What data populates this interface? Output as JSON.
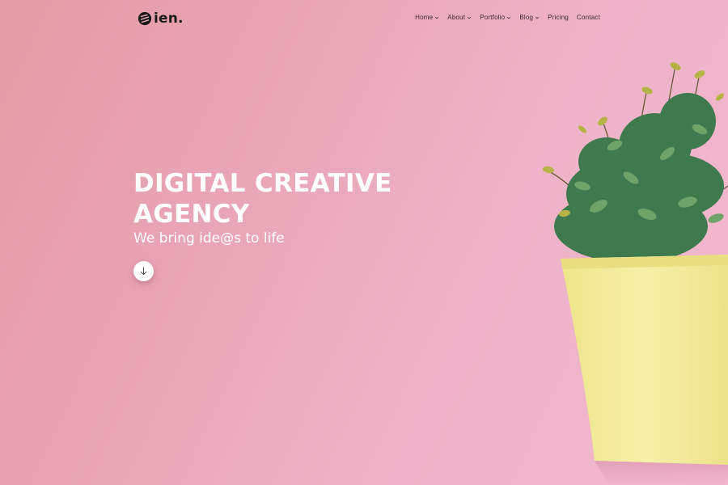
{
  "logo": {
    "text": "ien."
  },
  "nav": {
    "items": [
      {
        "label": "Home",
        "has_dropdown": true
      },
      {
        "label": "About",
        "has_dropdown": true
      },
      {
        "label": "Portfolio",
        "has_dropdown": true
      },
      {
        "label": "Blog",
        "has_dropdown": true
      },
      {
        "label": "Pricing",
        "has_dropdown": false
      },
      {
        "label": "Contact",
        "has_dropdown": false
      }
    ]
  },
  "hero": {
    "title": "DIGITAL CREATIVE AGENCY",
    "subtitle": "We bring ide@s to life",
    "scroll_icon": "arrow-down-icon"
  },
  "colors": {
    "bg_start": "#e49ba5",
    "bg_end": "#f0b8cf",
    "pot": "#f3ee9c",
    "leaf": "#3f7a4e",
    "text": "#ffffff"
  }
}
